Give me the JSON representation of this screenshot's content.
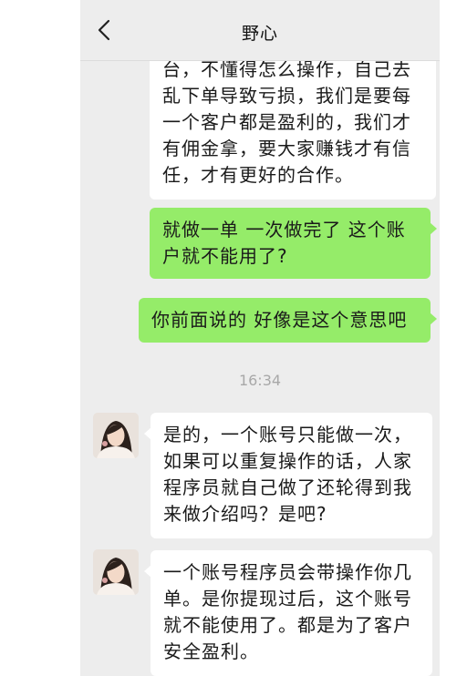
{
  "header": {
    "title": "野心",
    "back_icon": "chevron-left-icon"
  },
  "messages": [
    {
      "side": "left",
      "lines": [
        "台，不懂得怎么操作，自己去",
        "乱下单导致亏损，我们是要每",
        "一个客户都是盈利的，我们才",
        "有佣金拿，要大家赚钱才有信",
        "任，才有更好的合作。"
      ]
    },
    {
      "side": "right",
      "lines": [
        "就做一单  一次做完了  这个账",
        "户就不能用了?"
      ]
    },
    {
      "side": "right",
      "lines": [
        "你前面说的  好像是这个意思吧"
      ]
    },
    {
      "side": "left",
      "lines": [
        "是的，一个账号只能做一次，",
        "如果可以重复操作的话，人家",
        "程序员就自己做了还轮得到我",
        "来做介绍吗？是吧?"
      ]
    },
    {
      "side": "left",
      "lines": [
        "一个账号程序员会带操作你几",
        "单。是你提现过后，这个账号",
        "就不能使用了。都是为了客户",
        "安全盈利。"
      ]
    }
  ],
  "timestamp": "16:34",
  "colors": {
    "chat_bg": "#ededed",
    "sent_bubble": "#95ec69",
    "received_bubble": "#ffffff"
  }
}
